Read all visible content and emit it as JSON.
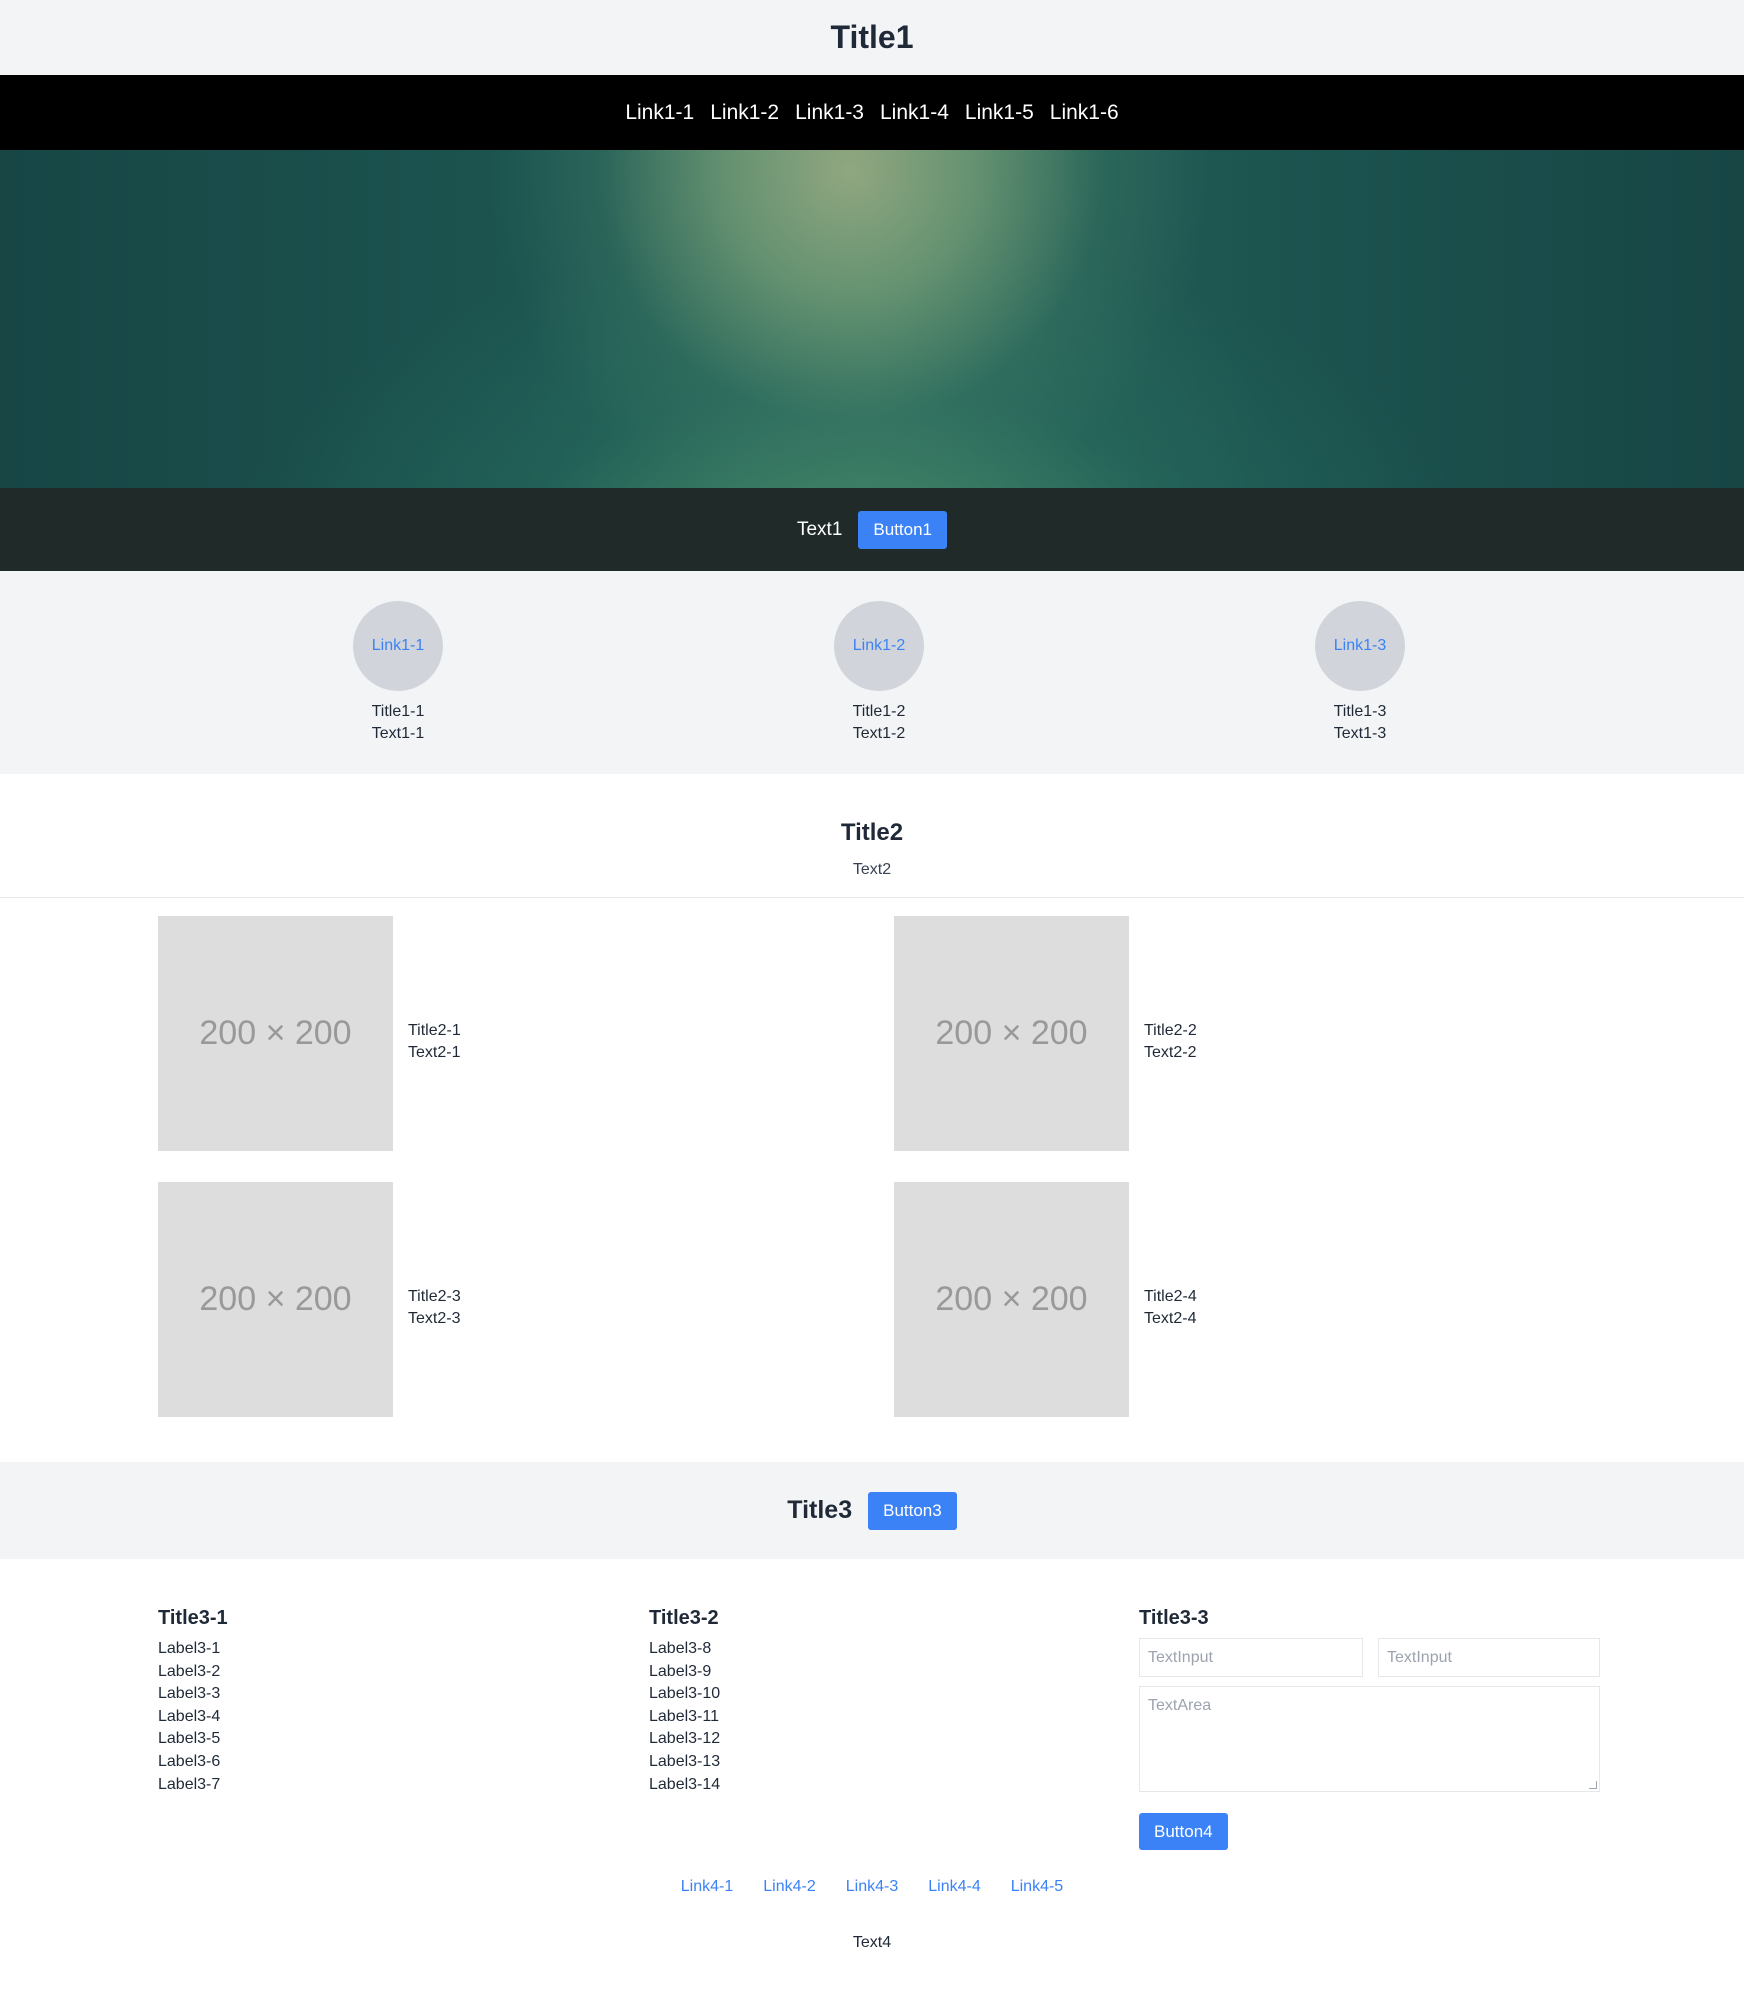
{
  "header": {
    "title": "Title1"
  },
  "nav": {
    "links": [
      "Link1-1",
      "Link1-2",
      "Link1-3",
      "Link1-4",
      "Link1-5",
      "Link1-6"
    ]
  },
  "cta": {
    "text": "Text1",
    "button": "Button1"
  },
  "features": [
    {
      "link": "Link1-1",
      "title": "Title1-1",
      "text": "Text1-1"
    },
    {
      "link": "Link1-2",
      "title": "Title1-2",
      "text": "Text1-2"
    },
    {
      "link": "Link1-3",
      "title": "Title1-3",
      "text": "Text1-3"
    }
  ],
  "section2": {
    "title": "Title2",
    "text": "Text2",
    "cards": [
      {
        "image": "200 × 200",
        "title": "Title2-1",
        "text": "Text2-1"
      },
      {
        "image": "200 × 200",
        "title": "Title2-2",
        "text": "Text2-2"
      },
      {
        "image": "200 × 200",
        "title": "Title2-3",
        "text": "Text2-3"
      },
      {
        "image": "200 × 200",
        "title": "Title2-4",
        "text": "Text2-4"
      }
    ]
  },
  "section3": {
    "title": "Title3",
    "button": "Button3",
    "columns": [
      {
        "title": "Title3-1",
        "labels": [
          "Label3-1",
          "Label3-2",
          "Label3-3",
          "Label3-4",
          "Label3-5",
          "Label3-6",
          "Label3-7"
        ]
      },
      {
        "title": "Title3-2",
        "labels": [
          "Label3-8",
          "Label3-9",
          "Label3-10",
          "Label3-11",
          "Label3-12",
          "Label3-13",
          "Label3-14"
        ]
      }
    ],
    "form": {
      "title": "Title3-3",
      "input1_placeholder": "TextInput",
      "input2_placeholder": "TextInput",
      "textarea_placeholder": "TextArea",
      "button": "Button4"
    }
  },
  "footer": {
    "links": [
      "Link4-1",
      "Link4-2",
      "Link4-3",
      "Link4-4",
      "Link4-5"
    ],
    "text": "Text4"
  },
  "colors": {
    "accent": "#3b82f6",
    "nav_bg": "#000000",
    "band_bg": "#1f2a29",
    "light_bg": "#f3f4f6",
    "placeholder_bg": "#dddddd"
  }
}
